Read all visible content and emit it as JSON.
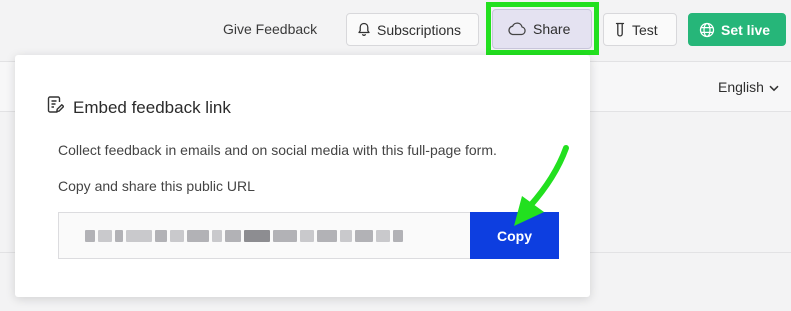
{
  "header": {
    "give_feedback": "Give Feedback",
    "subscriptions": "Subscriptions",
    "share": "Share",
    "test": "Test",
    "set_live": "Set live"
  },
  "subbar": {
    "language": "English"
  },
  "popover": {
    "title": "Embed feedback link",
    "description": "Collect feedback in emails and on social media with this full-page form.",
    "copy_label": "Copy and share this public URL",
    "copy_button": "Copy"
  },
  "colors": {
    "share_highlight": "#22e01f",
    "set_live_bg": "#26b679",
    "copy_bg": "#0d3ee0",
    "share_bg": "#e4e2f1"
  },
  "icons": {
    "subscriptions": "bell-icon",
    "share": "cloud-icon",
    "test": "flask-icon",
    "set_live": "globe-icon",
    "language": "chevron-down-icon",
    "embed": "document-edit-icon"
  }
}
